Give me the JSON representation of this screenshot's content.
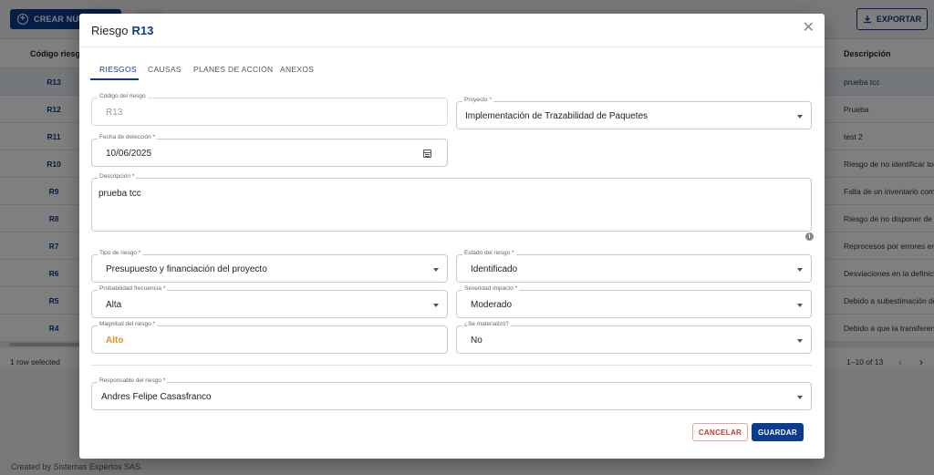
{
  "background": {
    "toolbar": {
      "create_label": "CREAR NUEVO",
      "export_label": "EXPORTAR"
    },
    "table": {
      "columns": [
        "Código riesgo",
        "Descripción"
      ],
      "rows": [
        {
          "code": "R13",
          "description": "prueba tcc"
        },
        {
          "code": "R12",
          "description": "Prueba"
        },
        {
          "code": "R11",
          "description": "test 2"
        },
        {
          "code": "R10",
          "description": "Riesgo de no identificar tod"
        },
        {
          "code": "R9",
          "description": "Falta de un inventario comp"
        },
        {
          "code": "R8",
          "description": "Riesgo de no disponer de la"
        },
        {
          "code": "R7",
          "description": "Reprocesos por errores en l"
        },
        {
          "code": "R6",
          "description": "Desviaciones en la definició"
        },
        {
          "code": "R5",
          "description": "Debido a subestimación de"
        },
        {
          "code": "R4",
          "description": "Debido a que la transferenc"
        }
      ],
      "selection_text": "1 row selected",
      "pagination_text": "1–10 of 13"
    },
    "credit": "Created by Sistemas Expertos SAS."
  },
  "dialog": {
    "title_prefix": "Riesgo",
    "title_code": "R13",
    "close_glyph": "✕",
    "tabs": [
      "RIESGOS",
      "CAUSAS",
      "PLANES DE ACCIÓN",
      "ANEXOS"
    ],
    "active_tab": "RIESGOS",
    "fields": {
      "codigo": {
        "label": "Código del riesgo",
        "value": "R13"
      },
      "proyecto": {
        "label": "Proyecto *",
        "value": "Implementación de Trazabilidad de Paquetes"
      },
      "fecha": {
        "label": "Fecha de detección *",
        "value": "10/06/2025"
      },
      "descripcion": {
        "label": "Descripción *",
        "value": "prueba tcc"
      },
      "tipo": {
        "label": "Tipo de riesgo *",
        "value": "Presupuesto y financiación del proyecto"
      },
      "estado": {
        "label": "Estado del riesgo *",
        "value": "Identificado"
      },
      "probabilidad": {
        "label": "Probabilidad frecuencia *",
        "value": "Alta"
      },
      "severidad": {
        "label": "Severidad impacto *",
        "value": "Moderado"
      },
      "magnitud": {
        "label": "Magnitud del riesgo *",
        "value": "Alto"
      },
      "materializo": {
        "label": "¿Se materializó?",
        "value": "No"
      },
      "responsable": {
        "label": "Responsable del riesgo *",
        "value": "Andres Felipe Casasfranco"
      }
    },
    "info_glyph": "i",
    "buttons": {
      "cancel": "CANCELAR",
      "save": "GUARDAR"
    }
  },
  "colors": {
    "primary": "#0d3b8e",
    "cancel": "#c0392b",
    "magnitude_high": "#f08a24"
  }
}
